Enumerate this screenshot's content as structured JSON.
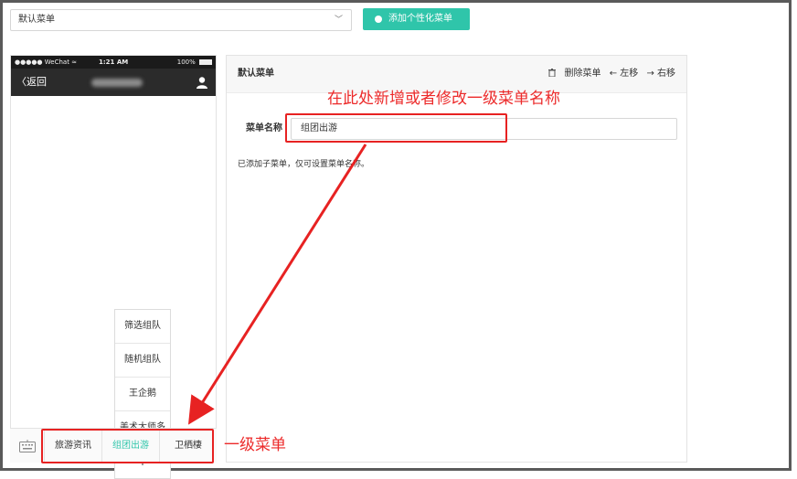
{
  "toolbar": {
    "menu_select_value": "默认菜单",
    "add_button_label": "添加个性化菜单"
  },
  "phone": {
    "status": {
      "signal": "●●●●● WeChat ≈",
      "time": "1:21 AM",
      "battery": "100%"
    },
    "nav": {
      "back_label": "〈返回"
    },
    "submenu": {
      "items": [
        "筛选组队",
        "随机组队",
        "王企鹅",
        "美术大师多",
        "+"
      ]
    },
    "main_menu": {
      "items": [
        "旅游资讯",
        "组团出游",
        "卫栖棲"
      ],
      "active_index": 1
    }
  },
  "panel": {
    "title": "默认菜单",
    "actions": {
      "delete_label": "删除菜单",
      "move_left_label": "← 左移",
      "move_right_label": "→ 右移"
    },
    "name_label": "菜单名称",
    "name_value": "组团出游",
    "hint": "已添加子菜单，仅可设置菜单名称。"
  },
  "annotations": {
    "top_text": "在此处新增或者修改一级菜单名称",
    "bottom_text": "一级菜单",
    "color": "#e72222"
  },
  "colors": {
    "accent": "#2fc5aa",
    "nav_dark": "#2b2b2b"
  }
}
